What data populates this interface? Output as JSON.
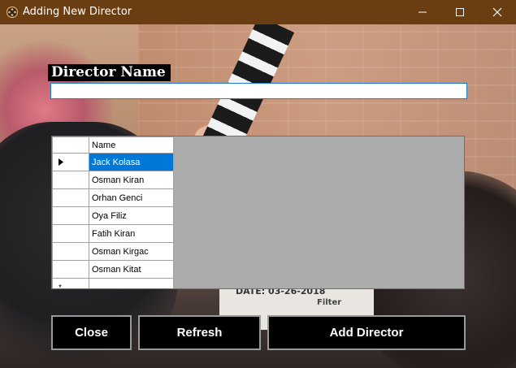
{
  "window": {
    "title": "Adding New Director",
    "icon": "film-reel-icon",
    "controls": {
      "minimize": "minimize-icon",
      "maximize": "maximize-icon",
      "close": "close-icon"
    },
    "title_bar_color": "#6b3d12"
  },
  "background": {
    "slate_text": "DATE: 03-26-2018",
    "slate_filter": "Filter"
  },
  "form": {
    "director_name_label": "Director Name",
    "director_name_value": "",
    "grid": {
      "columns": [
        "Name"
      ],
      "rows": [
        {
          "name": "Jack Kolasa",
          "selected": true
        },
        {
          "name": "Osman Kiran",
          "selected": false
        },
        {
          "name": "Orhan Genci",
          "selected": false
        },
        {
          "name": "Oya Filiz",
          "selected": false
        },
        {
          "name": "Fatih Kiran",
          "selected": false
        },
        {
          "name": "Osman Kirgac",
          "selected": false
        },
        {
          "name": "Osman Kitat",
          "selected": false
        }
      ],
      "new_row_marker": "*",
      "selection_color": "#0078d7"
    },
    "buttons": {
      "close": "Close",
      "refresh": "Refresh",
      "add_director": "Add Director"
    }
  }
}
